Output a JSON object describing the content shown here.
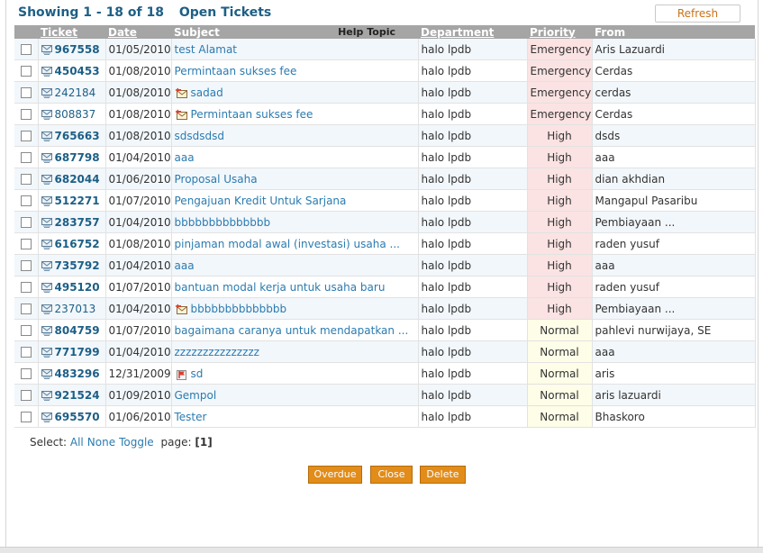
{
  "heading": {
    "showing": "Showing",
    "range": "1 - 18 of 18",
    "queue": "Open Tickets"
  },
  "refresh_label": "Refresh",
  "columns": {
    "ticket": "Ticket",
    "date": "Date",
    "subject": "Subject",
    "help_topic": "Help Topic",
    "department": "Department",
    "priority": "Priority",
    "from": "From"
  },
  "rows": [
    {
      "ticket": "967558",
      "date": "01/05/2010",
      "subject": "test Alamat",
      "department": "halo lpdb",
      "priority": "Emergency",
      "from": "Aris Lazuardi",
      "unread": true,
      "subject_icon": ""
    },
    {
      "ticket": "450453",
      "date": "01/08/2010",
      "subject": "Permintaan sukses fee",
      "department": "halo lpdb",
      "priority": "Emergency",
      "from": "Cerdas",
      "unread": true,
      "subject_icon": ""
    },
    {
      "ticket": "242184",
      "date": "01/08/2010",
      "subject": "sadad",
      "department": "halo lpdb",
      "priority": "Emergency",
      "from": "cerdas",
      "unread": false,
      "subject_icon": "reply-icon"
    },
    {
      "ticket": "808837",
      "date": "01/08/2010",
      "subject": "Permintaan sukses fee",
      "department": "halo lpdb",
      "priority": "Emergency",
      "from": "Cerdas",
      "unread": false,
      "subject_icon": "reply-icon"
    },
    {
      "ticket": "765663",
      "date": "01/08/2010",
      "subject": "sdsdsdsd",
      "department": "halo lpdb",
      "priority": "High",
      "from": "dsds",
      "unread": true,
      "subject_icon": ""
    },
    {
      "ticket": "687798",
      "date": "01/04/2010",
      "subject": "aaa",
      "department": "halo lpdb",
      "priority": "High",
      "from": "aaa",
      "unread": true,
      "subject_icon": ""
    },
    {
      "ticket": "682044",
      "date": "01/06/2010",
      "subject": "Proposal Usaha",
      "department": "halo lpdb",
      "priority": "High",
      "from": "dian akhdian",
      "unread": true,
      "subject_icon": ""
    },
    {
      "ticket": "512271",
      "date": "01/07/2010",
      "subject": "Pengajuan Kredit Untuk Sarjana",
      "department": "halo lpdb",
      "priority": "High",
      "from": "Mangapul Pasaribu",
      "unread": true,
      "subject_icon": ""
    },
    {
      "ticket": "283757",
      "date": "01/04/2010",
      "subject": "bbbbbbbbbbbbbb",
      "department": "halo lpdb",
      "priority": "High",
      "from": "Pembiayaan ...",
      "unread": true,
      "subject_icon": ""
    },
    {
      "ticket": "616752",
      "date": "01/08/2010",
      "subject": "pinjaman modal awal (investasi) usaha ...",
      "department": "halo lpdb",
      "priority": "High",
      "from": "raden yusuf",
      "unread": true,
      "subject_icon": ""
    },
    {
      "ticket": "735792",
      "date": "01/04/2010",
      "subject": "aaa",
      "department": "halo lpdb",
      "priority": "High",
      "from": "aaa",
      "unread": true,
      "subject_icon": ""
    },
    {
      "ticket": "495120",
      "date": "01/07/2010",
      "subject": "bantuan modal kerja untuk usaha baru",
      "department": "halo lpdb",
      "priority": "High",
      "from": "raden yusuf",
      "unread": true,
      "subject_icon": ""
    },
    {
      "ticket": "237013",
      "date": "01/04/2010",
      "subject": "bbbbbbbbbbbbbb",
      "department": "halo lpdb",
      "priority": "High",
      "from": "Pembiayaan ...",
      "unread": false,
      "subject_icon": "reply-icon"
    },
    {
      "ticket": "804759",
      "date": "01/07/2010",
      "subject": "bagaimana caranya untuk mendapatkan ...",
      "department": "halo lpdb",
      "priority": "Normal",
      "from": "pahlevi nurwijaya, SE",
      "unread": true,
      "subject_icon": ""
    },
    {
      "ticket": "771799",
      "date": "01/04/2010",
      "subject": "zzzzzzzzzzzzzzz",
      "department": "halo lpdb",
      "priority": "Normal",
      "from": "aaa",
      "unread": true,
      "subject_icon": ""
    },
    {
      "ticket": "483296",
      "date": "12/31/2009",
      "subject": "sd",
      "department": "halo lpdb",
      "priority": "Normal",
      "from": "aris",
      "unread": true,
      "subject_icon": "flag-icon"
    },
    {
      "ticket": "921524",
      "date": "01/09/2010",
      "subject": "Gempol",
      "department": "halo lpdb",
      "priority": "Normal",
      "from": "aris lazuardi",
      "unread": true,
      "subject_icon": ""
    },
    {
      "ticket": "695570",
      "date": "01/06/2010",
      "subject": "Tester",
      "department": "halo lpdb",
      "priority": "Normal",
      "from": "Bhaskoro",
      "unread": true,
      "subject_icon": ""
    }
  ],
  "select": {
    "label": "Select:",
    "all": "All",
    "none": "None",
    "toggle": "Toggle",
    "page_label": "page:",
    "page_value": "[1]"
  },
  "buttons": {
    "overdue": "Overdue",
    "close": "Close",
    "delete": "Delete"
  },
  "colors": {
    "title": "#1d5f86",
    "link": "#2b7bb0",
    "header_bg": "#a5a5a5",
    "button": "#e28c1a",
    "priority_high_bg": "#fbe3e3",
    "priority_normal_bg": "#fdfde8"
  }
}
